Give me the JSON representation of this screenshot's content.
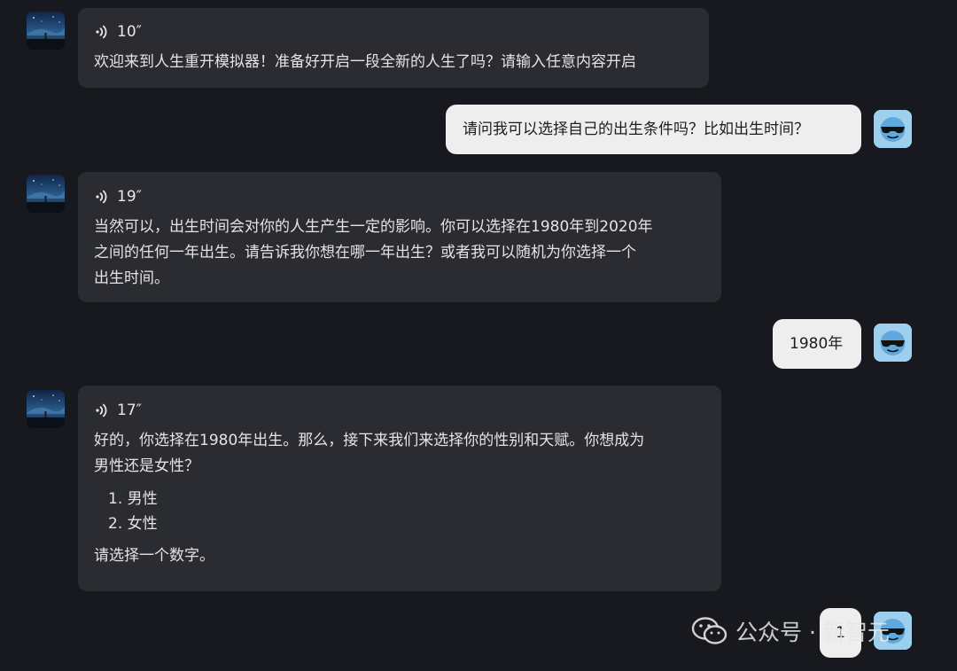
{
  "messages": [
    {
      "role": "bot",
      "duration": "10″",
      "text": "欢迎来到人生重开模拟器！准备好开启一段全新的人生了吗？请输入任意内容开启"
    },
    {
      "role": "user",
      "text": "请问我可以选择自己的出生条件吗？比如出生时间？"
    },
    {
      "role": "bot",
      "duration": "19″",
      "lines": [
        "当然可以，出生时间会对你的人生产生一定的影响。你可以选择在1980年到2020年",
        "之间的任何一年出生。请告诉我你想在哪一年出生？或者我可以随机为你选择一个",
        "出生时间。"
      ]
    },
    {
      "role": "user",
      "text": "1980年"
    },
    {
      "role": "bot",
      "duration": "17″",
      "lines": [
        "好的，你选择在1980年出生。那么，接下来我们来选择你的性别和天赋。你想成为",
        "男性还是女性？"
      ],
      "options": [
        "1. 男性",
        "2. 女性"
      ],
      "closing": "请选择一个数字。"
    },
    {
      "role": "user",
      "text": "1"
    }
  ],
  "watermark": {
    "text": "公众号 · 新智元",
    "icon": "wechat-icon"
  },
  "icons": {
    "bot_avatar": "night-sky-avatar",
    "user_avatar": "sunglasses-emoji-avatar",
    "voice": "voice-wave-icon"
  },
  "colors": {
    "background": "#17191e",
    "bot_bubble": "#2b2c31",
    "user_bubble": "#eeeeee",
    "user_avatar_bg": "#9ed0ee"
  }
}
